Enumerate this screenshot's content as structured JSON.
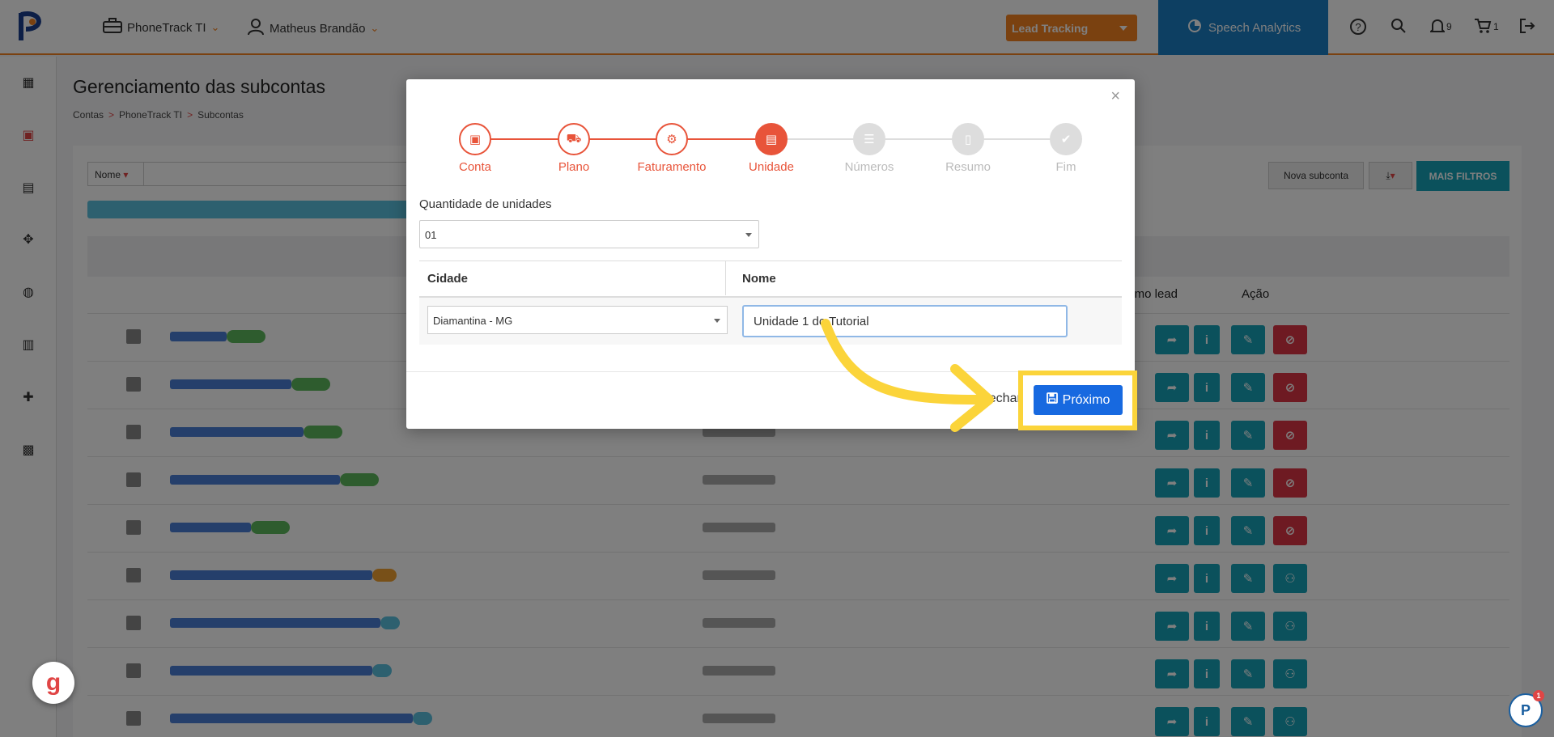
{
  "topbar": {
    "company": "PhoneTrack TI",
    "user": "Matheus Brandão",
    "lead_tracking": "Lead Tracking",
    "speech_analytics": "Speech Analytics",
    "notifications_count": "9",
    "cart_count": "1",
    "accent_color": "#f58220"
  },
  "page": {
    "title": "Gerenciamento das subcontas",
    "breadcrumb": [
      "Contas",
      "PhoneTrack TI",
      "Subcontas"
    ],
    "filter_field": "Nome",
    "buttons": {
      "nova_subconta": "Nova subconta",
      "mais_filtros": "MAIS FILTROS"
    },
    "columns": {
      "ultimo_lead": "Último lead",
      "acao": "Ação"
    }
  },
  "modal": {
    "steps": [
      {
        "label": "Conta",
        "state": "done",
        "icon": "briefcase-icon"
      },
      {
        "label": "Plano",
        "state": "done",
        "icon": "cart-icon"
      },
      {
        "label": "Faturamento",
        "state": "done",
        "icon": "gears-icon"
      },
      {
        "label": "Unidade",
        "state": "active",
        "icon": "building-icon"
      },
      {
        "label": "Números",
        "state": "todo",
        "icon": "list-icon"
      },
      {
        "label": "Resumo",
        "state": "todo",
        "icon": "document-icon"
      },
      {
        "label": "Fim",
        "state": "todo",
        "icon": "check-icon"
      }
    ],
    "quantity_label": "Quantidade de unidades",
    "quantity_value": "01",
    "table": {
      "col_city": "Cidade",
      "col_name": "Nome",
      "city_value": "Diamantina - MG",
      "name_value": "Unidade 1 do Tutorial"
    },
    "close_label": "Fechar",
    "next_label": "Próximo"
  },
  "colors": {
    "step_active": "#e8543a",
    "primary_blue": "#1769e0",
    "highlight_yellow": "#fbd43a",
    "teal": "#17a2b8"
  }
}
